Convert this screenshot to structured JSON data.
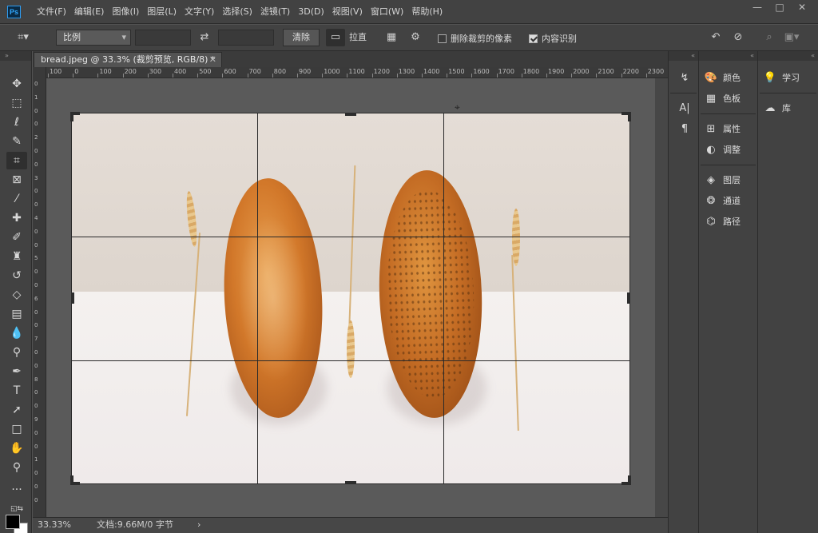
{
  "app": {
    "logo_text": "Ps"
  },
  "menu": [
    "文件(F)",
    "编辑(E)",
    "图像(I)",
    "图层(L)",
    "文字(Y)",
    "选择(S)",
    "滤镜(T)",
    "3D(D)",
    "视图(V)",
    "窗口(W)",
    "帮助(H)"
  ],
  "window_controls": {
    "minimize": "—",
    "restore": "□",
    "close": "✕"
  },
  "options_bar": {
    "ratio_select": "比例",
    "width_value": "",
    "height_value": "",
    "clear_button": "清除",
    "straighten_label": "拉直",
    "delete_cropped_label": "删除裁剪的像素",
    "delete_cropped_checked": false,
    "content_aware_label": "内容识别",
    "content_aware_checked": true
  },
  "document": {
    "tab_title": "bread.jpeg @ 33.3% (裁剪预览, RGB/8) *",
    "ruler_top": [
      "100",
      "0",
      "100",
      "200",
      "300",
      "400",
      "500",
      "600",
      "700",
      "800",
      "900",
      "1000",
      "1100",
      "1200",
      "1300",
      "1400",
      "1500",
      "1600",
      "1700",
      "1800",
      "1900",
      "2000",
      "2100",
      "2200",
      "2300"
    ],
    "ruler_left": [
      "0",
      "1",
      "0",
      "0",
      "2",
      "0",
      "0",
      "3",
      "0",
      "0",
      "4",
      "0",
      "0",
      "5",
      "0",
      "0",
      "6",
      "0",
      "0",
      "7",
      "0",
      "0",
      "8",
      "0",
      "0",
      "9",
      "0",
      "0",
      "1",
      "0",
      "0",
      "0"
    ]
  },
  "status": {
    "zoom": "33.33%",
    "doc_info": "文档:9.66M/0 字节",
    "arrow": "›"
  },
  "panels": {
    "strip": [
      "history-icon",
      "character-icon",
      "paragraph-icon"
    ],
    "group1": [
      {
        "icon": "color-icon",
        "label": "颜色"
      },
      {
        "icon": "swatches-icon",
        "label": "色板"
      }
    ],
    "group2": [
      {
        "icon": "properties-icon",
        "label": "属性"
      },
      {
        "icon": "adjustments-icon",
        "label": "调整"
      }
    ],
    "group3": [
      {
        "icon": "layers-icon",
        "label": "图层"
      },
      {
        "icon": "channels-icon",
        "label": "通道"
      },
      {
        "icon": "paths-icon",
        "label": "路径"
      }
    ],
    "right": [
      {
        "icon": "learn-icon",
        "label": "学习"
      },
      {
        "icon": "libraries-icon",
        "label": "库"
      }
    ]
  },
  "colors": {
    "foreground": "#000000",
    "background": "#ffffff",
    "accent": "#31a8ff"
  }
}
